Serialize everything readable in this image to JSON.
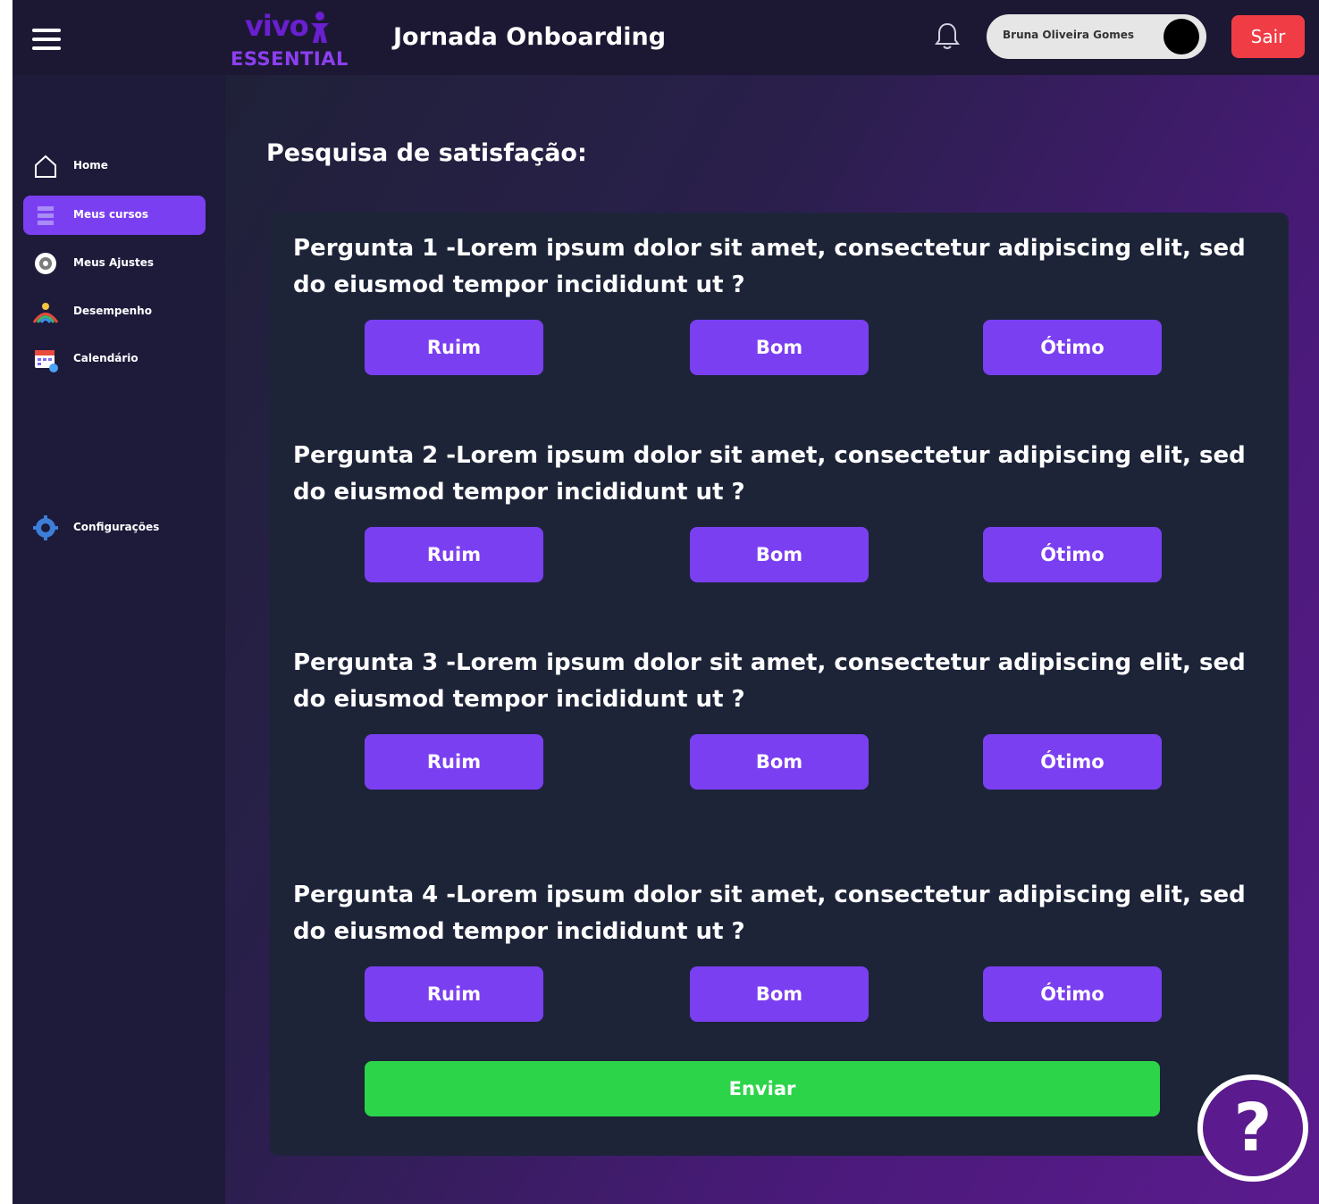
{
  "header": {
    "logo_top": "vivo",
    "logo_bottom": "ESSENTIAL",
    "title": "Jornada Onboarding",
    "user_name": "Bruna Oliveira Gomes",
    "logout_label": "Sair"
  },
  "sidebar": {
    "items": [
      {
        "label": "Home",
        "icon": "home-icon",
        "active": false
      },
      {
        "label": "Meus cursos",
        "icon": "courses-icon",
        "active": true
      },
      {
        "label": "Meus Ajustes",
        "icon": "adjustments-icon",
        "active": false
      },
      {
        "label": "Desempenho",
        "icon": "performance-icon",
        "active": false
      },
      {
        "label": "Calendário",
        "icon": "calendar-icon",
        "active": false
      }
    ],
    "settings_label": "Configurações"
  },
  "main": {
    "title": "Pesquisa de satisfação:",
    "questions": [
      {
        "text": "Pergunta 1 -Lorem ipsum dolor sit amet, consectetur adipiscing elit, sed do eiusmod tempor incididunt ut ?",
        "options": [
          "Ruim",
          "Bom",
          "Ótimo"
        ]
      },
      {
        "text": "Pergunta 2 -Lorem ipsum dolor sit amet, consectetur adipiscing elit, sed do eiusmod tempor incididunt ut ?",
        "options": [
          "Ruim",
          "Bom",
          "Ótimo"
        ]
      },
      {
        "text": "Pergunta 3 -Lorem ipsum dolor sit amet, consectetur adipiscing elit, sed do eiusmod tempor incididunt ut ?",
        "options": [
          "Ruim",
          "Bom",
          "Ótimo"
        ]
      },
      {
        "text": "Pergunta 4 -Lorem ipsum dolor sit amet, consectetur adipiscing elit, sed do eiusmod tempor incididunt ut ?",
        "options": [
          "Ruim",
          "Bom",
          "Ótimo"
        ]
      }
    ],
    "submit_label": "Enviar"
  },
  "help": {
    "label": "?"
  },
  "colors": {
    "accent": "#7b3ff2",
    "submit": "#2cd44a",
    "logout": "#f03c45",
    "card": "#1d2438",
    "sidebar": "#1e1a3a"
  }
}
